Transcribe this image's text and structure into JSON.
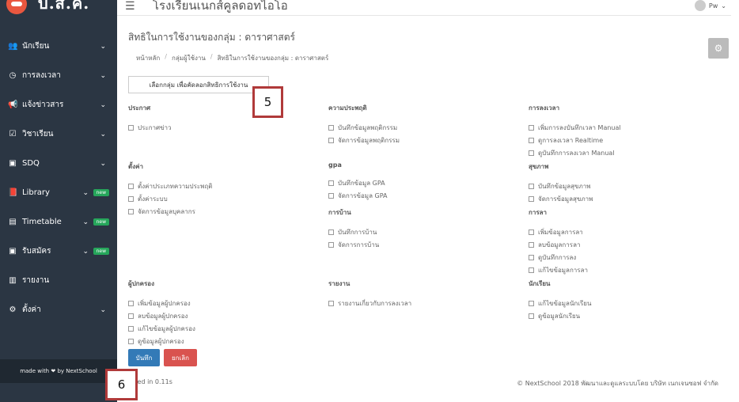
{
  "brand": {
    "title": "บ.ส.ค."
  },
  "sidebar": {
    "items": [
      {
        "label": "นักเรียน",
        "icon": "users-icon"
      },
      {
        "label": "การลงเวลา",
        "icon": "clock-icon"
      },
      {
        "label": "แจ้งข่าวสาร",
        "icon": "megaphone-icon"
      },
      {
        "label": "วิชาเรียน",
        "icon": "calendar-check-icon"
      },
      {
        "label": "SDQ",
        "icon": "clipboard-icon"
      },
      {
        "label": "Library",
        "icon": "book-icon",
        "badge": "new"
      },
      {
        "label": "Timetable",
        "icon": "database-icon",
        "badge": "new"
      },
      {
        "label": "รับสมัคร",
        "icon": "clipboard-icon",
        "badge": "new"
      },
      {
        "label": "รายงาน",
        "icon": "bar-chart-icon"
      },
      {
        "label": "ตั้งค่า",
        "icon": "cogs-icon"
      }
    ],
    "footer": "made with ❤ by NextSchool"
  },
  "topbar": {
    "school": "โรงเรียนเนกส์คูลดอทไอโอ",
    "user": "Pw"
  },
  "page": {
    "title": "สิทธิในการใช้งานของกลุ่ม : ดาราศาสตร์",
    "breadcrumb": [
      "หน้าหลัก",
      "กลุ่มผู้ใช้งาน",
      "สิทธิในการใช้งานของกลุ่ม : ดาราศาสตร์"
    ],
    "copy_button": "เลือกกลุ่ม เพื่อคัดลอกสิทธิการใช้งาน"
  },
  "sections": [
    {
      "title": "ประกาศ",
      "items": [
        "ประกาศข่าว"
      ]
    },
    {
      "title": "ความประพฤติ",
      "items": [
        "บันทึกข้อมูลพฤติกรรม",
        "จัดการข้อมูลพฤติกรรม"
      ]
    },
    {
      "title": "การลงเวลา",
      "items": [
        "เพิ่มการลงบันทึกเวลา Manual",
        "ดูการลงเวลา Realtime",
        "ดูบันทึกการลงเวลา Manual"
      ]
    },
    {
      "title": "ตั้งค่า",
      "items": [
        "ตั้งค่าประเภทความประพฤติ",
        "ตั้งค่าระบบ",
        "จัดการข้อมูลบุคลากร"
      ]
    },
    {
      "title": "gpa",
      "items": [
        "บันทึกข้อมูล GPA",
        "จัดการข้อมูล GPA"
      ]
    },
    {
      "title": "สุขภาพ",
      "items": [
        "บันทึกข้อมูลสุขภาพ",
        "จัดการข้อมูลสุขภาพ"
      ]
    },
    {
      "title": "การบ้าน",
      "items": [
        "บันทึกการบ้าน",
        "จัดการการบ้าน"
      ]
    },
    {
      "title": "การลา",
      "items": [
        "เพิ่มข้อมูลการลา",
        "ลบข้อมูลการลา",
        "ดูบันทึกการลง",
        "แก้ไขข้อมูลการลา"
      ]
    },
    {
      "title": "ผู้ปกครอง",
      "items": [
        "เพิ่มข้อมูลผู้ปกครอง",
        "ลบข้อมูลผู้ปกครอง",
        "แก้ไขข้อมูลผู้ปกครอง",
        "ดูข้อมูลผู้ปกครอง"
      ]
    },
    {
      "title": "รายงาน",
      "items": [
        "รายงานเกี่ยวกับการลงเวลา"
      ]
    },
    {
      "title": "นักเรียน",
      "items": [
        "แก้ไขข้อมูลนักเรียน",
        "ดูข้อมูลนักเรียน"
      ]
    }
  ],
  "actions": {
    "save": "บันทึก",
    "cancel": "ยกเลิก"
  },
  "footer": {
    "exec": "ecuted in 0.11s",
    "copyright": "© NextSchool 2018 พัฒนาและดูแลระบบโดย บริษัท เนกเจนซอฟ จำกัด"
  },
  "markers": {
    "m5": "5",
    "m6": "6"
  },
  "colors": {
    "sidebar": "#2b3643",
    "accent_save": "#337ab7",
    "accent_cancel": "#d9534f",
    "marker_border": "#b03a3a"
  }
}
